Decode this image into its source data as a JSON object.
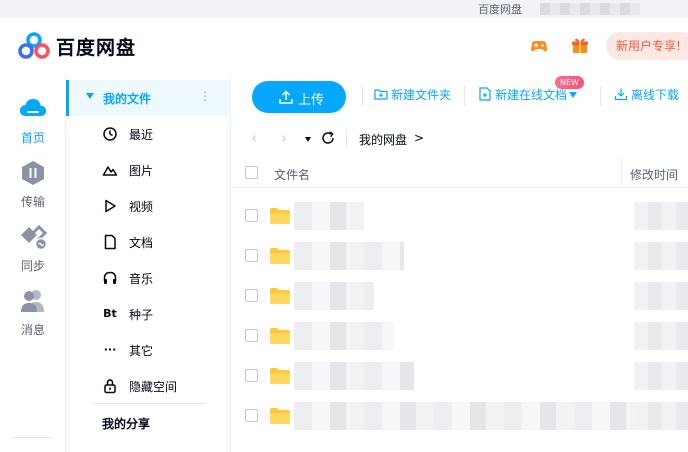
{
  "window": {
    "title": "百度网盘"
  },
  "header": {
    "brand": "百度网盘",
    "promo": "新用户专享!",
    "icons": [
      "game-icon",
      "gift-icon"
    ]
  },
  "rail": {
    "items": [
      {
        "label": "首页",
        "icon": "cloud-icon",
        "active": true
      },
      {
        "label": "传输",
        "icon": "transfer-icon",
        "active": false
      },
      {
        "label": "同步",
        "icon": "sync-icon",
        "active": false
      },
      {
        "label": "消息",
        "icon": "people-icon",
        "active": false
      }
    ]
  },
  "sidebar": {
    "my_files": "我的文件",
    "items": [
      {
        "label": "最近",
        "icon": "clock-icon"
      },
      {
        "label": "图片",
        "icon": "mountain-icon"
      },
      {
        "label": "视频",
        "icon": "play-icon"
      },
      {
        "label": "文档",
        "icon": "document-icon"
      },
      {
        "label": "音乐",
        "icon": "headphones-icon"
      },
      {
        "label": "种子",
        "icon": "bt-icon",
        "glyph": "Bt"
      },
      {
        "label": "其它",
        "icon": "more-dots-icon",
        "glyph": "···"
      },
      {
        "label": "隐藏空间",
        "icon": "lock-icon"
      }
    ],
    "my_share": "我的分享"
  },
  "toolbar": {
    "upload": "上传",
    "new_folder": "新建文件夹",
    "new_online_doc": "新建在线文档",
    "new_badge": "NEW",
    "offline_download": "离线下载"
  },
  "nav": {
    "breadcrumb": "我的网盘",
    "breadcrumb_arrow": ">"
  },
  "table": {
    "col_name": "文件名",
    "col_time": "修改时间",
    "rows": 6
  },
  "colors": {
    "accent": "#06a7ff",
    "promo_bg": "#fde9e3",
    "promo_text": "#f25c3b",
    "folder": "#ffc93b"
  }
}
